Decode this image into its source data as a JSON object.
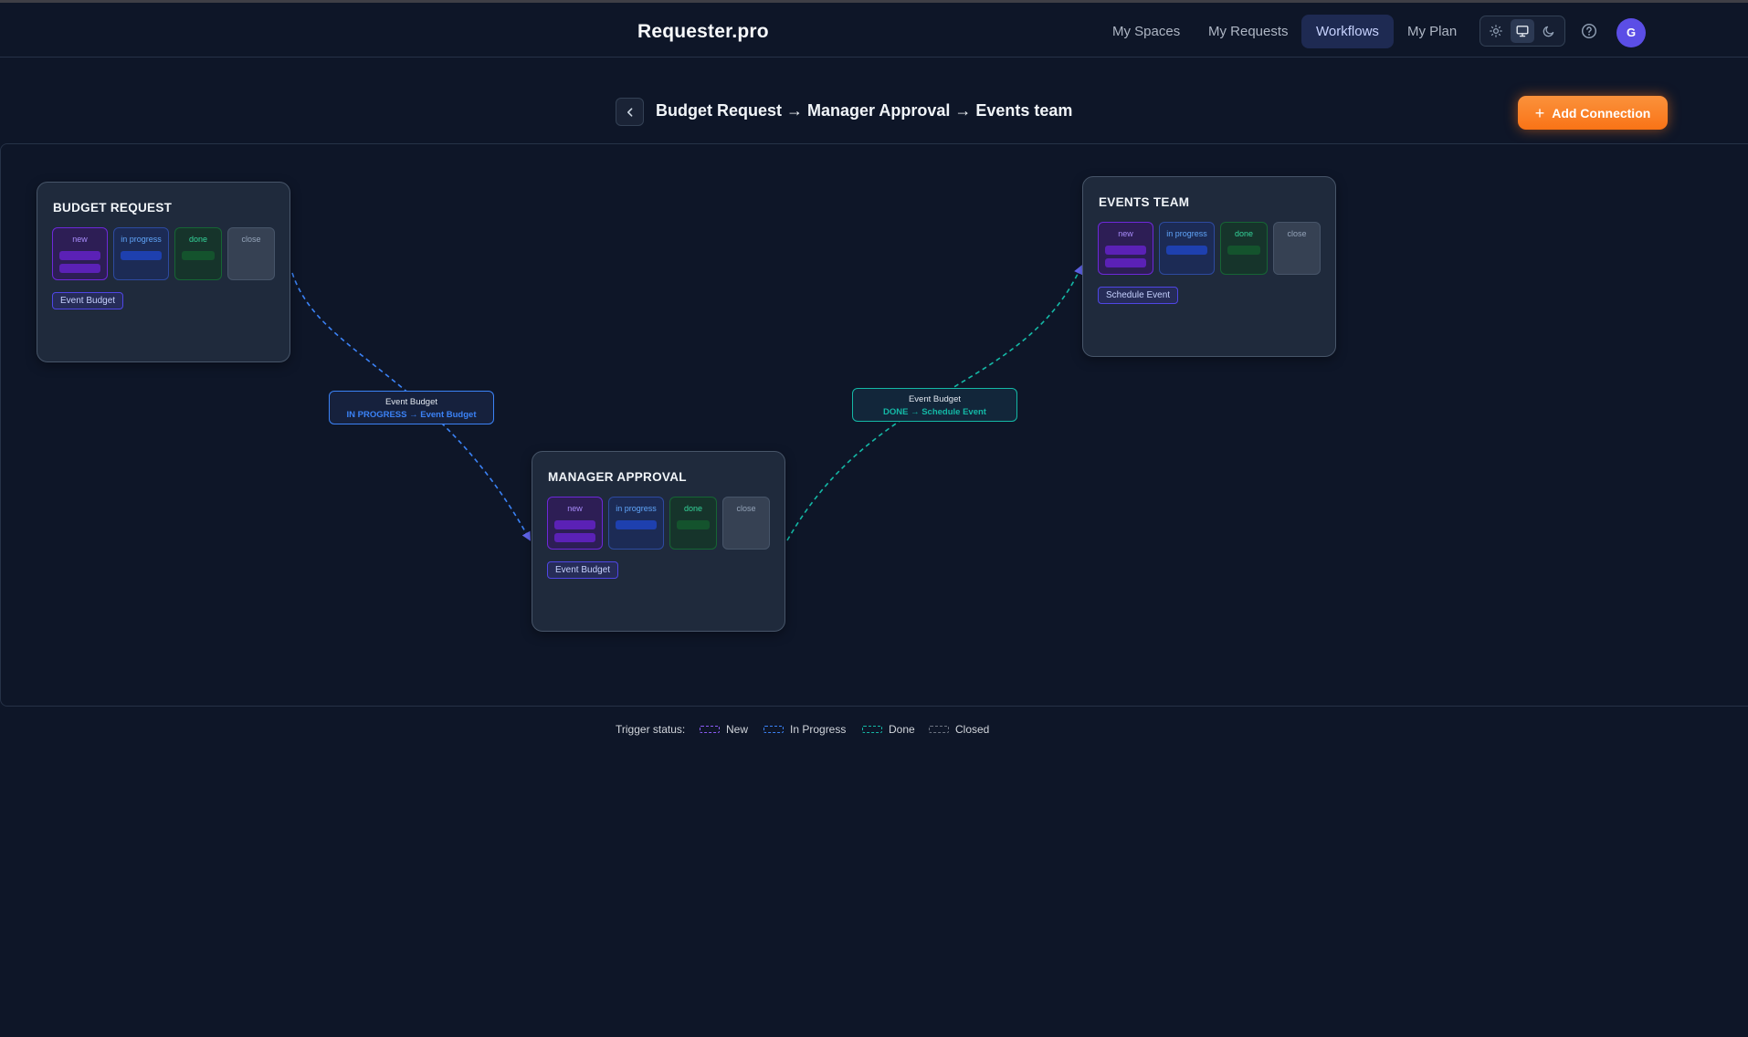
{
  "header": {
    "brand": "Requester.pro",
    "nav": [
      {
        "label": "My Spaces",
        "active": false
      },
      {
        "label": "My Requests",
        "active": false
      },
      {
        "label": "Workflows",
        "active": true
      },
      {
        "label": "My Plan",
        "active": false
      }
    ],
    "theme_options": [
      "sun-icon",
      "monitor-icon",
      "moon-icon"
    ],
    "theme_selected": "monitor-icon",
    "avatar_initial": "G"
  },
  "toolbar": {
    "title": "Budget Request → Manager Approval → Events team",
    "add_connection_label": "Add Connection"
  },
  "nodes": [
    {
      "title": "BUDGET REQUEST",
      "statuses": [
        "new",
        "in progress",
        "done",
        "close"
      ],
      "tag": "Event Budget"
    },
    {
      "title": "MANAGER APPROVAL",
      "statuses": [
        "new",
        "in progress",
        "done",
        "close"
      ],
      "tag": "Event Budget"
    },
    {
      "title": "EVENTS TEAM",
      "statuses": [
        "new",
        "in progress",
        "done",
        "close"
      ],
      "tag": "Schedule Event"
    }
  ],
  "connections": [
    {
      "name": "Event Budget",
      "rule": "IN PROGRESS → Event Budget",
      "color": "#3b82f6"
    },
    {
      "name": "Event Budget",
      "rule": "DONE → Schedule Event",
      "color": "#14b8a6"
    }
  ],
  "legend": {
    "title": "Trigger status:",
    "items": [
      {
        "label": "New",
        "color": "#8b5cf6"
      },
      {
        "label": "In Progress",
        "color": "#3b82f6"
      },
      {
        "label": "Done",
        "color": "#14b8a6"
      },
      {
        "label": "Closed",
        "color": "#6b7280"
      }
    ]
  },
  "colors": {
    "background": "#0e1628",
    "accent_orange": "#f97316",
    "active_nav": "#1e2a52",
    "in_progress": "#3b82f6",
    "done": "#14b8a6"
  }
}
